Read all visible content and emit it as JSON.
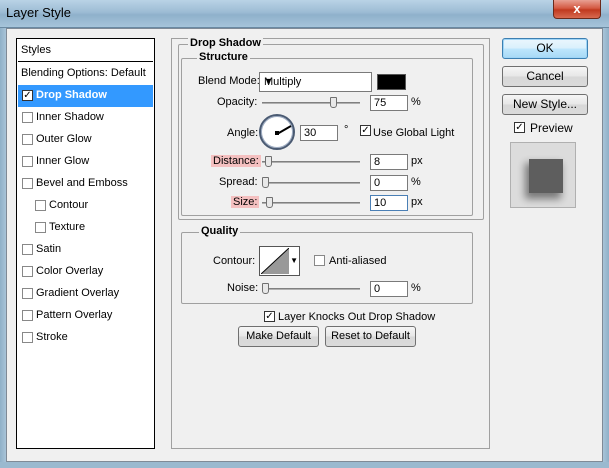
{
  "window": {
    "title": "Layer Style",
    "close_glyph": "x"
  },
  "styles_panel": {
    "header": "Styles",
    "items": [
      {
        "label": "Blending Options: Default",
        "checkbox": false,
        "checked": false,
        "selected": false,
        "indent": 0
      },
      {
        "label": "Drop Shadow",
        "checkbox": true,
        "checked": true,
        "selected": true,
        "indent": 0
      },
      {
        "label": "Inner Shadow",
        "checkbox": true,
        "checked": false,
        "selected": false,
        "indent": 0
      },
      {
        "label": "Outer Glow",
        "checkbox": true,
        "checked": false,
        "selected": false,
        "indent": 0
      },
      {
        "label": "Inner Glow",
        "checkbox": true,
        "checked": false,
        "selected": false,
        "indent": 0
      },
      {
        "label": "Bevel and Emboss",
        "checkbox": true,
        "checked": false,
        "selected": false,
        "indent": 0
      },
      {
        "label": "Contour",
        "checkbox": true,
        "checked": false,
        "selected": false,
        "indent": 1
      },
      {
        "label": "Texture",
        "checkbox": true,
        "checked": false,
        "selected": false,
        "indent": 1
      },
      {
        "label": "Satin",
        "checkbox": true,
        "checked": false,
        "selected": false,
        "indent": 0
      },
      {
        "label": "Color Overlay",
        "checkbox": true,
        "checked": false,
        "selected": false,
        "indent": 0
      },
      {
        "label": "Gradient Overlay",
        "checkbox": true,
        "checked": false,
        "selected": false,
        "indent": 0
      },
      {
        "label": "Pattern Overlay",
        "checkbox": true,
        "checked": false,
        "selected": false,
        "indent": 0
      },
      {
        "label": "Stroke",
        "checkbox": true,
        "checked": false,
        "selected": false,
        "indent": 0
      }
    ]
  },
  "drop_shadow": {
    "section_title": "Drop Shadow",
    "structure": {
      "title": "Structure",
      "blend_mode_label": "Blend Mode:",
      "blend_mode_value": "Multiply",
      "shadow_color": "#000000",
      "opacity_label": "Opacity:",
      "opacity_value": "75",
      "opacity_unit": "%",
      "opacity_level": 0.75,
      "angle_label": "Angle:",
      "angle_value": "30",
      "angle_unit": "°",
      "use_global_light_label": "Use Global Light",
      "use_global_light_checked": true,
      "distance_label": "Distance:",
      "distance_value": "8",
      "distance_unit": "px",
      "distance_level": 0.03,
      "spread_label": "Spread:",
      "spread_value": "0",
      "spread_unit": "%",
      "spread_level": 0.0,
      "size_label": "Size:",
      "size_value": "10",
      "size_unit": "px",
      "size_level": 0.04
    },
    "quality": {
      "title": "Quality",
      "contour_label": "Contour:",
      "anti_aliased_label": "Anti-aliased",
      "anti_aliased_checked": false,
      "noise_label": "Noise:",
      "noise_value": "0",
      "noise_unit": "%",
      "noise_level": 0.0
    },
    "knocks_out_label": "Layer Knocks Out Drop Shadow",
    "knocks_out_checked": true,
    "make_default_label": "Make Default",
    "reset_default_label": "Reset to Default"
  },
  "buttons": {
    "ok": "OK",
    "cancel": "Cancel",
    "new_style": "New Style..."
  },
  "preview": {
    "label": "Preview",
    "checked": true
  },
  "colors": {
    "selection": "#3399ff",
    "highlight_label": "#f4c0c0"
  }
}
